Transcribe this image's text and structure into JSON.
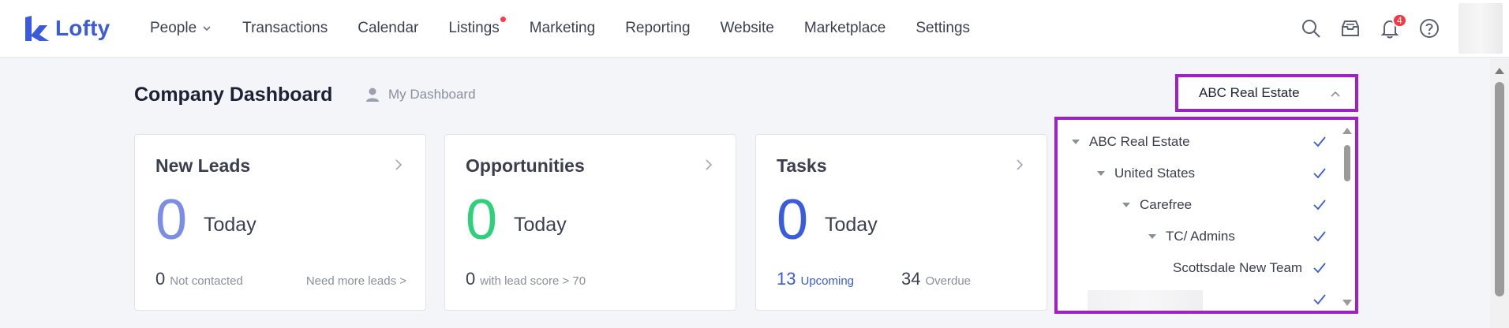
{
  "app": {
    "brand": "Lofty",
    "accent": "#3a5bdc"
  },
  "nav": {
    "items": [
      {
        "label": "People",
        "has_dropdown": true
      },
      {
        "label": "Transactions"
      },
      {
        "label": "Calendar"
      },
      {
        "label": "Listings",
        "has_dot": true
      },
      {
        "label": "Marketing"
      },
      {
        "label": "Reporting"
      },
      {
        "label": "Website"
      },
      {
        "label": "Marketplace"
      },
      {
        "label": "Settings"
      }
    ]
  },
  "top_icons": {
    "notifications_count": "4"
  },
  "page": {
    "title": "Company Dashboard",
    "my_dashboard": "My Dashboard"
  },
  "company_select": {
    "value": "ABC Real Estate"
  },
  "cards": {
    "new_leads": {
      "title": "New Leads",
      "value": "0",
      "period": "Today",
      "foot_count": "0",
      "foot_text": "Not contacted",
      "link": "Need more leads >",
      "color": "#7b8de4"
    },
    "opportunities": {
      "title": "Opportunities",
      "value": "0",
      "period": "Today",
      "foot_count": "0",
      "foot_text": "with lead score > 70",
      "color": "#2fd07a"
    },
    "tasks": {
      "title": "Tasks",
      "value": "0",
      "period": "Today",
      "upcoming_count": "13",
      "upcoming_label": "Upcoming",
      "overdue_count": "34",
      "overdue_label": "Overdue",
      "color": "#3a5bdc"
    }
  },
  "tree": {
    "items": [
      {
        "label": "ABC Real Estate",
        "level": 0,
        "expanded": true,
        "checked": true
      },
      {
        "label": "United States",
        "level": 1,
        "expanded": true,
        "checked": true
      },
      {
        "label": "Carefree",
        "level": 2,
        "expanded": true,
        "checked": true
      },
      {
        "label": "TC/ Admins",
        "level": 3,
        "expanded": true,
        "checked": true
      },
      {
        "label": "Scottsdale New Team",
        "level": 4,
        "expanded": false,
        "checked": true
      }
    ]
  }
}
